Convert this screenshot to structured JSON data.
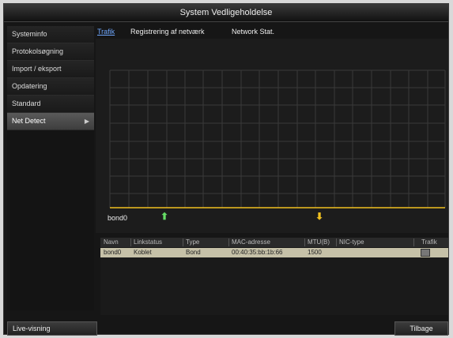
{
  "window": {
    "title": "System Vedligeholdelse"
  },
  "sidebar": {
    "items": [
      {
        "label": "Systeminfo",
        "active": false
      },
      {
        "label": "Protokolsøgning",
        "active": false
      },
      {
        "label": "Import / eksport",
        "active": false
      },
      {
        "label": "Opdatering",
        "active": false
      },
      {
        "label": "Standard",
        "active": false
      },
      {
        "label": "Net Detect",
        "active": true
      }
    ],
    "arrow_icon": "chevron-right-icon",
    "live_label": "Live-visning"
  },
  "tabs": [
    {
      "label": "Trafik",
      "active": true
    },
    {
      "label": "Registrering af netværk",
      "active": false
    },
    {
      "label": "Network Stat.",
      "active": false
    }
  ],
  "traffic": {
    "interface_label": "bond0",
    "upload_icon": "arrow-up-icon",
    "download_icon": "arrow-down-icon",
    "line_color": "#f0c020"
  },
  "table": {
    "headers": [
      "Navn",
      "Linkstatus",
      "Type",
      "MAC-adresse",
      "MTU(B)",
      "NIC-type",
      "Trafik"
    ],
    "rows": [
      [
        "bond0",
        "Koblet",
        "Bond",
        "00:40:35:bb:1b:66",
        "1500",
        "",
        ""
      ]
    ]
  },
  "footer": {
    "back_label": "Tilbage"
  }
}
